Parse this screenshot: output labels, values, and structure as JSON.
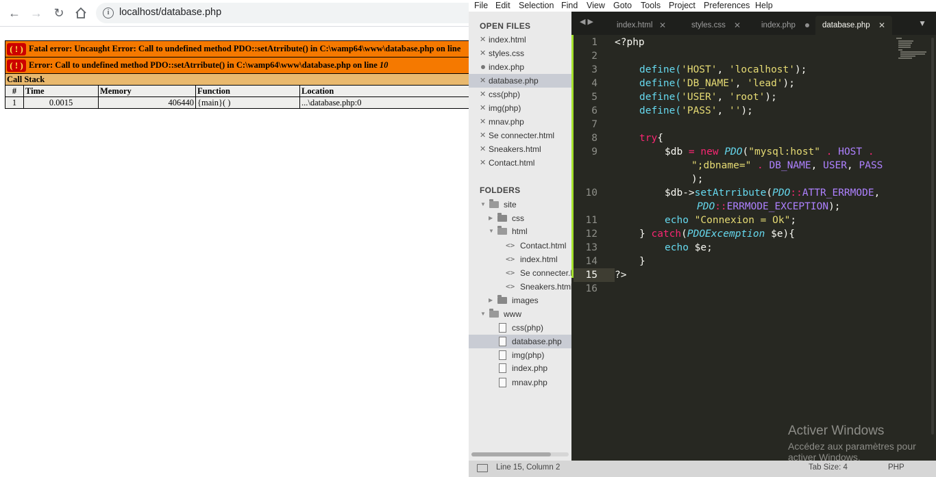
{
  "browser": {
    "url": "localhost/database.php",
    "icons": {
      "back": "arrow-left-icon",
      "forward": "arrow-right-icon",
      "reload": "reload-icon",
      "home": "home-icon",
      "info": "info-icon"
    }
  },
  "xdebug": {
    "error1": "Fatal error: Uncaught Error: Call to undefined method PDO::setAtrribute() in C:\\wamp64\\www\\database.php on line",
    "error2": "Error: Call to undefined method PDO::setAtrribute() in C:\\wamp64\\www\\database.php on line ",
    "error2_line": "10",
    "bang": "( ! )",
    "call_stack_title": "Call Stack",
    "headers": [
      "#",
      "Time",
      "Memory",
      "Function",
      "Location"
    ],
    "rows": [
      {
        "num": "1",
        "time": "0.0015",
        "memory": "406440",
        "function": "{main}( )",
        "location": "...\\database.php:0"
      }
    ]
  },
  "sublime": {
    "menu": [
      "File",
      "Edit",
      "Selection",
      "Find",
      "View",
      "Goto",
      "Tools",
      "Project",
      "Preferences",
      "Help"
    ],
    "sidebar": {
      "open_files_heading": "OPEN FILES",
      "open_files": [
        "index.html",
        "styles.css",
        "index.php",
        "database.php",
        "css(php)",
        "img(php)",
        "mnav.php",
        "Se connecter.html",
        "Sneakers.html",
        "Contact.html"
      ],
      "folders_heading": "FOLDERS",
      "tree": [
        "site",
        "css",
        "html",
        "Contact.html",
        "index.html",
        "Se connecter.html",
        "Sneakers.html",
        "images",
        "www",
        "css(php)",
        "database.php",
        "img(php)",
        "index.php",
        "mnav.php"
      ]
    },
    "tabs": [
      "index.html",
      "styles.css",
      "index.php",
      "database.php"
    ],
    "code": {
      "l1": "<?php",
      "l3a": "define(",
      "l3b": "'HOST'",
      "l3c": ", ",
      "l3d": "'localhost'",
      "l3e": ");",
      "l4a": "define(",
      "l4b": "'DB_NAME'",
      "l4c": ", ",
      "l4d": "'lead'",
      "l4e": ");",
      "l5a": "define(",
      "l5b": "'USER'",
      "l5c": ", ",
      "l5d": "'root'",
      "l5e": ");",
      "l6a": "define(",
      "l6b": "'PASS'",
      "l6c": ", ",
      "l6d": "''",
      "l6e": ");",
      "l8a": "try",
      "l8b": "{",
      "l9a": "$db ",
      "l9b": "= new ",
      "l9c": "PDO",
      "l9d": "(",
      "l9e": "\"mysql:host\"",
      "l9f": " . ",
      "l9g": "HOST",
      "l9h": " .",
      "l9w1a": "\";dbname=\"",
      "l9w1b": " . ",
      "l9w1c": "DB_NAME",
      "l9w1d": ", ",
      "l9w1e": "USER",
      "l9w1f": ", ",
      "l9w1g": "PASS",
      "l9w2": ");",
      "l10a": "$db->",
      "l10b": "setAtrribute",
      "l10c": "(",
      "l10d": "PDO",
      "l10e": "::",
      "l10f": "ATTR_ERRMODE",
      "l10g": ",",
      "l10w1a": "PDO",
      "l10w1b": "::",
      "l10w1c": "ERRMODE_EXCEPTION",
      "l10w1d": ");",
      "l11a": "echo ",
      "l11b": "\"Connexion = Ok\"",
      "l11c": ";",
      "l12a": "} ",
      "l12b": "catch",
      "l12c": "(",
      "l12d": "PDOExcemption",
      "l12e": " $e){",
      "l13a": "echo ",
      "l13b": "$e;",
      "l14": "}",
      "l15": "?>"
    },
    "watermark": {
      "title": "Activer Windows",
      "subtitle": "Accédez aux paramètres pour activer Windows."
    },
    "status": {
      "position": "Line 15, Column 2",
      "tab_size": "Tab Size: 4",
      "syntax": "PHP"
    }
  }
}
